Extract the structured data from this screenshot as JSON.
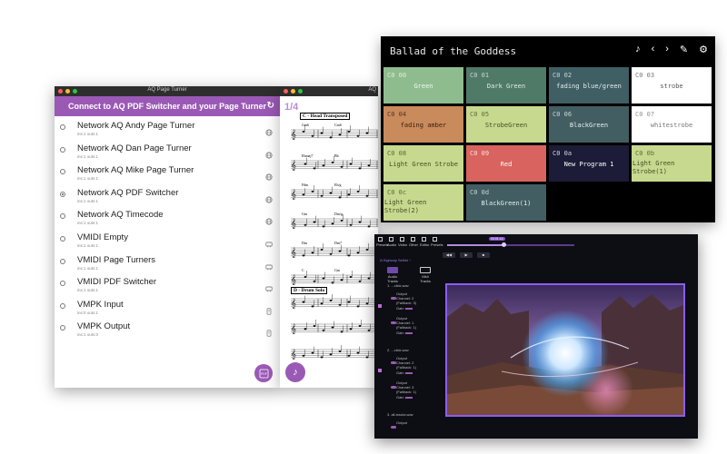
{
  "page_turner": {
    "window_title": "AQ Page Turner",
    "header": "Connect to AQ PDF Switcher and your Page Turner",
    "items": [
      {
        "name": "Network AQ Andy Page Turner",
        "ports": "ins:1 outs:1",
        "selected": false,
        "icon": "globe-icon"
      },
      {
        "name": "Network AQ Dan Page Turner",
        "ports": "ins:1 outs:1",
        "selected": false,
        "icon": "globe-icon"
      },
      {
        "name": "Network AQ Mike Page Turner",
        "ports": "ins:1 outs:1",
        "selected": false,
        "icon": "globe-icon"
      },
      {
        "name": "Network AQ PDF Switcher",
        "ports": "ins:1 outs:1",
        "selected": true,
        "icon": "globe-icon"
      },
      {
        "name": "Network AQ Timecode",
        "ports": "ins:1 outs:1",
        "selected": false,
        "icon": "globe-icon"
      },
      {
        "name": "VMIDI Empty",
        "ports": "ins:1 outs:1",
        "selected": false,
        "icon": "cable-icon"
      },
      {
        "name": "VMIDI Page Turners",
        "ports": "ins:1 outs:1",
        "selected": false,
        "icon": "cable-icon"
      },
      {
        "name": "VMIDI PDF Switcher",
        "ports": "ins:1 outs:1",
        "selected": false,
        "icon": "cable-icon"
      },
      {
        "name": "VMPK Input",
        "ports": "ins:0 outs:1",
        "selected": false,
        "icon": "device-icon"
      },
      {
        "name": "VMPK Output",
        "ports": "ins:1 outs:0",
        "selected": false,
        "icon": "device-icon"
      }
    ],
    "pdf_button": "PDF"
  },
  "sheet_music": {
    "window_title": "AQ",
    "page_indicator": "1/4",
    "section_c": "C - Head Transposed",
    "section_d": "D - Drum Solo",
    "chords": [
      "Gm6",
      "Cm6",
      "Ebmaj7",
      "Bb",
      "F#m",
      "Eb/g",
      "Gm",
      "Dm/g",
      "Dm",
      "Dm7",
      "C",
      "Gm"
    ]
  },
  "ballad": {
    "title": "Ballad of the Goddess",
    "icons": [
      "music-note-icon",
      "chevron-left-icon",
      "chevron-right-icon",
      "pencil-icon",
      "gear-icon"
    ],
    "cells": [
      {
        "num": "C0 00",
        "label": "Green",
        "bg": "#8fbc8f",
        "fg": "#f0f8f0"
      },
      {
        "num": "C0 01",
        "label": "Dark Green",
        "bg": "#4f7a68",
        "fg": "#e0ece6"
      },
      {
        "num": "C0 02",
        "label": "fading blue/green",
        "bg": "#3f5f64",
        "fg": "#e6eef0"
      },
      {
        "num": "C0 03",
        "label": "strobe",
        "bg": "#ffffff",
        "fg": "#555555"
      },
      {
        "num": "C0 04",
        "label": "fading amber",
        "bg": "#c98a5c",
        "fg": "#3a2210"
      },
      {
        "num": "C0 05",
        "label": "StrobeGreen",
        "bg": "#c6d98f",
        "fg": "#445022"
      },
      {
        "num": "C0 06",
        "label": "BlackGreen",
        "bg": "#425e62",
        "fg": "#e6eef0"
      },
      {
        "num": "C0 07",
        "label": "whitestrobe",
        "bg": "#ffffff",
        "fg": "#777777"
      },
      {
        "num": "C0 08",
        "label": "Light Green Strobe",
        "bg": "#c6d98f",
        "fg": "#445022"
      },
      {
        "num": "C0 09",
        "label": "Red",
        "bg": "#d9635f",
        "fg": "#ffffff"
      },
      {
        "num": "C0 0a",
        "label": "New Program 1",
        "bg": "#1c1c38",
        "fg": "#ffffff"
      },
      {
        "num": "C0 0b",
        "label": "Light Green Strobe(1)",
        "bg": "#c6d98f",
        "fg": "#445022"
      },
      {
        "num": "C0 0c",
        "label": "Light Green Strobe(2)",
        "bg": "#c6d98f",
        "fg": "#445022"
      },
      {
        "num": "C0 0d",
        "label": "BlackGreen(1)",
        "bg": "#425e62",
        "fg": "#e6eef0"
      }
    ]
  },
  "video_app": {
    "toolbar": [
      "Presets",
      "Audio",
      "Video",
      "Other",
      "Editor",
      "Presets"
    ],
    "time_label": "00:01:14",
    "transport": [
      "◀◀",
      "▶",
      "■"
    ],
    "setlist": "A Highway Setlist ~",
    "tabs": [
      "Audio Tracks",
      "Midi Tracks"
    ],
    "tracks": [
      {
        "file": "1. ...click.wav",
        "outputs": [
          {
            "label": "Output",
            "channel": "Channel: 2",
            "fallback": "(Fallback: 3)"
          },
          {
            "label": "Output",
            "channel": "Channel: 1",
            "fallback": "(Fallback: 1)"
          }
        ]
      },
      {
        "file": "2. ...click.wav",
        "outputs": [
          {
            "label": "Output",
            "channel": "Channel: 2",
            "fallback": "(Fallback: 1)"
          },
          {
            "label": "Output",
            "channel": "Channel: 3",
            "fallback": "(Fallback: 1)"
          }
        ]
      },
      {
        "file": "3. all-tracks.wav",
        "outputs": [
          {
            "label": "Output",
            "channel": "",
            "fallback": ""
          }
        ]
      }
    ],
    "gain_label": "Gain",
    "accent": "#8b5cf6"
  }
}
